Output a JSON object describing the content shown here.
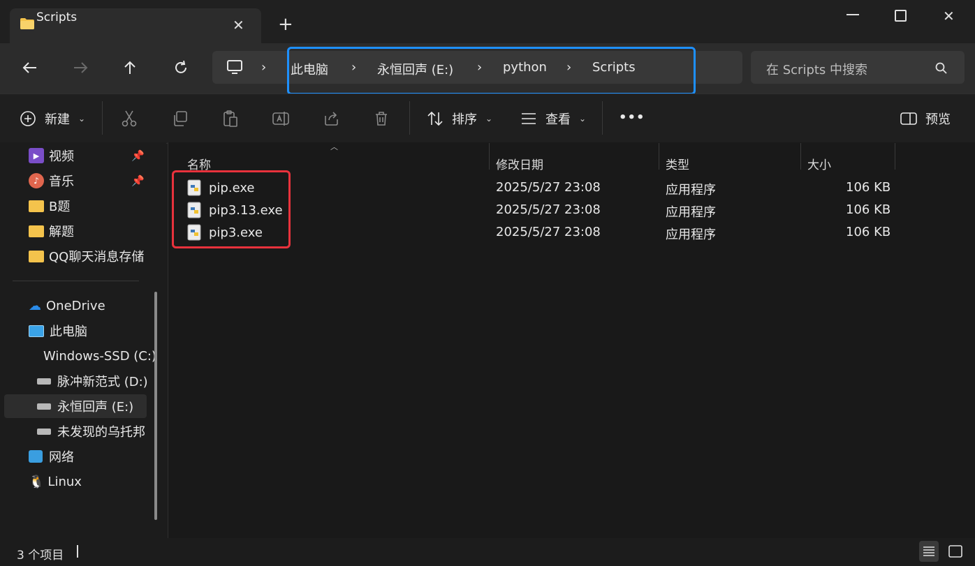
{
  "window": {
    "tab_title": "Scripts",
    "new_tab_label": "+",
    "minimize_label": "—",
    "close_label": "✕"
  },
  "nav": {
    "breadcrumb": [
      "此电脑",
      "永恒回声 (E:)",
      "python",
      "Scripts"
    ],
    "search_placeholder": "在 Scripts 中搜索"
  },
  "commandbar": {
    "new_label": "新建",
    "sort_label": "排序",
    "view_label": "查看",
    "more_label": "•••",
    "preview_label": "预览"
  },
  "sidebar": {
    "quick": [
      {
        "label": "视频",
        "pinned": true
      },
      {
        "label": "音乐",
        "pinned": true
      },
      {
        "label": "B题",
        "pinned": false
      },
      {
        "label": "解题",
        "pinned": false
      },
      {
        "label": "QQ聊天消息存储",
        "pinned": false
      }
    ],
    "tree": [
      {
        "label": "OneDrive"
      },
      {
        "label": "此电脑"
      },
      {
        "label": "Windows-SSD (C:)"
      },
      {
        "label": "脉冲新范式 (D:)"
      },
      {
        "label": "永恒回声 (E:)"
      },
      {
        "label": "未发现的乌托邦"
      },
      {
        "label": "网络"
      },
      {
        "label": "Linux"
      }
    ]
  },
  "table": {
    "headers": {
      "name": "名称",
      "modified": "修改日期",
      "type": "类型",
      "size": "大小"
    },
    "rows": [
      {
        "name": "pip.exe",
        "modified": "2025/5/27 23:08",
        "type": "应用程序",
        "size": "106 KB"
      },
      {
        "name": "pip3.13.exe",
        "modified": "2025/5/27 23:08",
        "type": "应用程序",
        "size": "106 KB"
      },
      {
        "name": "pip3.exe",
        "modified": "2025/5/27 23:08",
        "type": "应用程序",
        "size": "106 KB"
      }
    ]
  },
  "status": {
    "item_count": "3 个项目"
  },
  "colors": {
    "address_highlight": "#1e90ff",
    "selection_highlight": "#e8323c",
    "folder": "#f4c34c"
  }
}
